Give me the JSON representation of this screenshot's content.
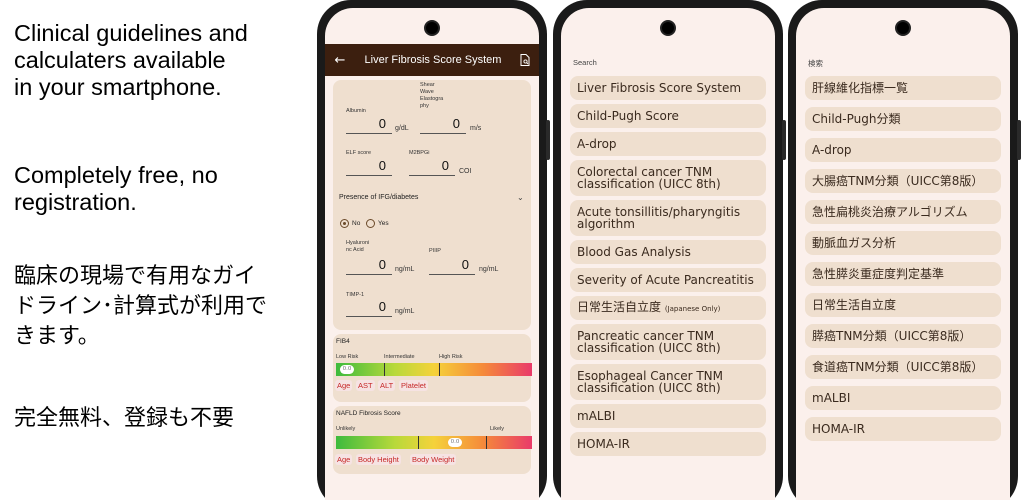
{
  "promo": {
    "en_line1": "Clinical guidelines and",
    "en_line2": "calculaters available",
    "en_line3": "in your smartphone.",
    "free_line1": "Completely free, no",
    "free_line2": "registration.",
    "jp_line1": "臨床の現場で有用なガイ",
    "jp_line2": "ドライン･計算式が利用で",
    "jp_line3": "きます。",
    "jp_free": "完全無料、登録も不要"
  },
  "calculator": {
    "back_icon": "arrow-left-icon",
    "title": "Liver Fibrosis Score System",
    "doc_icon": "document-search-icon",
    "albumin_label": "Albumin",
    "albumin_value": "0",
    "albumin_unit": "g/dL",
    "swe_label_1": "Shear",
    "swe_label_2": "Wave",
    "swe_label_3": "Elastogra",
    "swe_label_4": "phy",
    "swe_value": "0",
    "swe_unit": "m/s",
    "elf_label": "ELF score",
    "elf_value": "0",
    "m2bpgi_label": "M2BPGi",
    "m2bpgi_value": "0",
    "m2bpgi_unit": "COI",
    "ifg_section": "Presence of IFG/diabetes",
    "radio_no": "No",
    "radio_yes": "Yes",
    "radio_selected": "No",
    "ha_label_1": "Hyaluroni",
    "ha_label_2": "nc Acid",
    "ha_value": "0",
    "ha_unit": "ng/mL",
    "p3np_label": "PIIIP",
    "p3np_value": "0",
    "p3np_unit": "ng/mL",
    "timp_label": "TIMP-1",
    "timp_value": "0",
    "timp_unit": "ng/mL",
    "fib4": {
      "title": "FIB4",
      "low": "Low Risk",
      "mid": "Intermediate",
      "high": "High Risk",
      "value": "0.0",
      "chips": [
        "Age",
        "AST",
        "ALT",
        "Platelet"
      ]
    },
    "nafld": {
      "title": "NAFLD Fibrosis Score",
      "unlikely": "Unlikely",
      "likely": "Likely",
      "value": "0.0",
      "chips": [
        "Age",
        "Body Height",
        "Body Weight"
      ]
    }
  },
  "list_en": {
    "search_label": "Search",
    "items": [
      "Liver Fibrosis Score System",
      "Child-Pugh Score",
      "A-drop",
      "Colorectal cancer TNM",
      "classification (UICC 8th)",
      "Acute tonsillitis/pharyngitis",
      "algorithm",
      "Blood Gas Analysis",
      "Severity of Acute Pancreatitis",
      "日常生活自立度",
      "(Japanese Only)",
      "Pancreatic cancer TNM",
      "classification (UICC 8th)",
      "Esophageal Cancer TNM",
      "classification (UICC 8th)",
      "mALBI",
      "HOMA-IR"
    ]
  },
  "list_jp": {
    "search_label": "検索",
    "items": [
      "肝線維化指標一覧",
      "Child-Pugh分類",
      "A-drop",
      "大腸癌TNM分類（UICC第8版）",
      "急性扁桃炎治療アルゴリズム",
      "動脈血ガス分析",
      "急性膵炎重症度判定基準",
      "日常生活自立度",
      "膵癌TNM分類（UICC第8版）",
      "食道癌TNM分類（UICC第8版）",
      "mALBI",
      "HOMA-IR"
    ]
  }
}
